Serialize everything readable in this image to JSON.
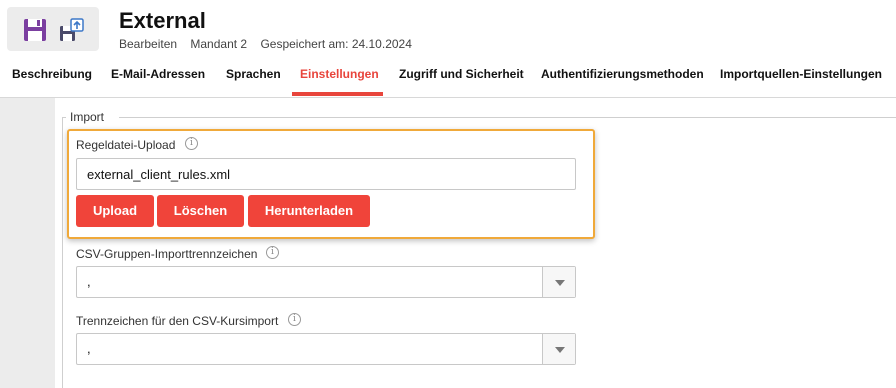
{
  "header": {
    "title": "External",
    "subtitle": {
      "mode": "Bearbeiten",
      "tenant": "Mandant 2",
      "saved": "Gespeichert am: 24.10.2024"
    },
    "toolbar": {
      "save_icon": "floppy-disk-icon",
      "save_as_icon": "floppy-disk-upload-icon"
    }
  },
  "tabs": [
    {
      "label": "Beschreibung",
      "active": false
    },
    {
      "label": "E-Mail-Adressen",
      "active": false
    },
    {
      "label": "Sprachen",
      "active": false
    },
    {
      "label": "Einstellungen",
      "active": true
    },
    {
      "label": "Zugriff und Sicherheit",
      "active": false
    },
    {
      "label": "Authentifizierungsmethoden",
      "active": false
    },
    {
      "label": "Importquellen-Einstellungen",
      "active": false
    }
  ],
  "import": {
    "legend": "Import",
    "rule_upload": {
      "label": "Regeldatei-Upload",
      "value": "external_client_rules.xml",
      "buttons": {
        "upload": "Upload",
        "delete": "Löschen",
        "download": "Herunterladen"
      }
    },
    "csv_group_separator": {
      "label": "CSV-Gruppen-Importtrennzeichen",
      "value": ","
    },
    "csv_course_separator": {
      "label": "Trennzeichen für den CSV-Kursimport",
      "value": ","
    }
  },
  "colors": {
    "accent": "#f0443a",
    "highlight": "#f0a93a",
    "icon_purple": "#7b3fa0"
  }
}
